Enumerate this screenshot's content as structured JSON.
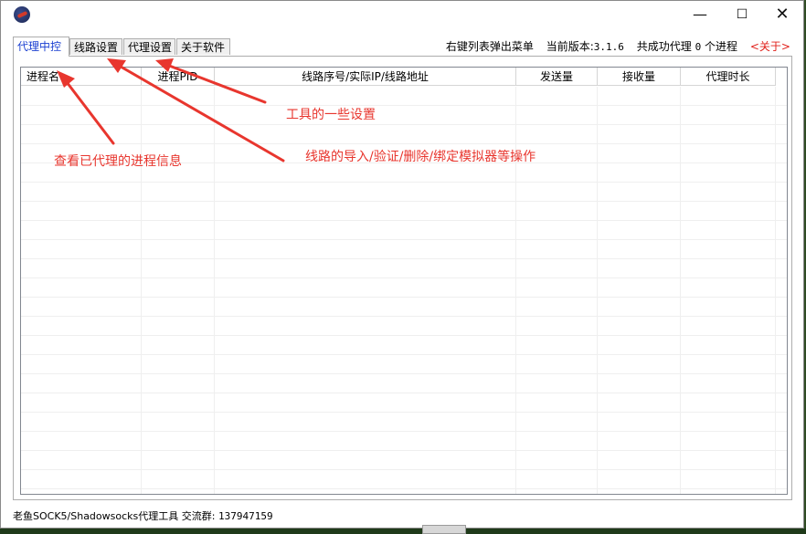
{
  "window": {
    "minimize_glyph": "—",
    "maximize_glyph": "☐",
    "close_glyph": "✕"
  },
  "tabs": [
    {
      "label": "代理中控",
      "active": true
    },
    {
      "label": "线路设置",
      "active": false
    },
    {
      "label": "代理设置",
      "active": false
    },
    {
      "label": "关于软件",
      "active": false
    }
  ],
  "status": {
    "context_menu_hint": "右键列表弹出菜单",
    "version_label": "当前版本:",
    "version": "3.1.6",
    "success_prefix": "共成功代理",
    "success_count": "0",
    "success_suffix": "个进程",
    "about_link": "<关于>"
  },
  "list": {
    "columns": [
      "进程名",
      "进程PID",
      "线路序号/实际IP/线路地址",
      "发送量",
      "接收量",
      "代理时长"
    ],
    "rows": []
  },
  "footer": {
    "text": "老鱼SOCK5/Shadowsocks代理工具 交流群:",
    "group_id": "137947159"
  },
  "annotations": {
    "tool_settings": "工具的一些设置",
    "proxied_process_info": "查看已代理的进程信息",
    "line_operations": "线路的导入/验证/删除/绑定模拟器等操作"
  },
  "colors": {
    "active_tab": "#1a3fd1",
    "annotation": "#e8362e",
    "about_link": "#e0201a"
  }
}
